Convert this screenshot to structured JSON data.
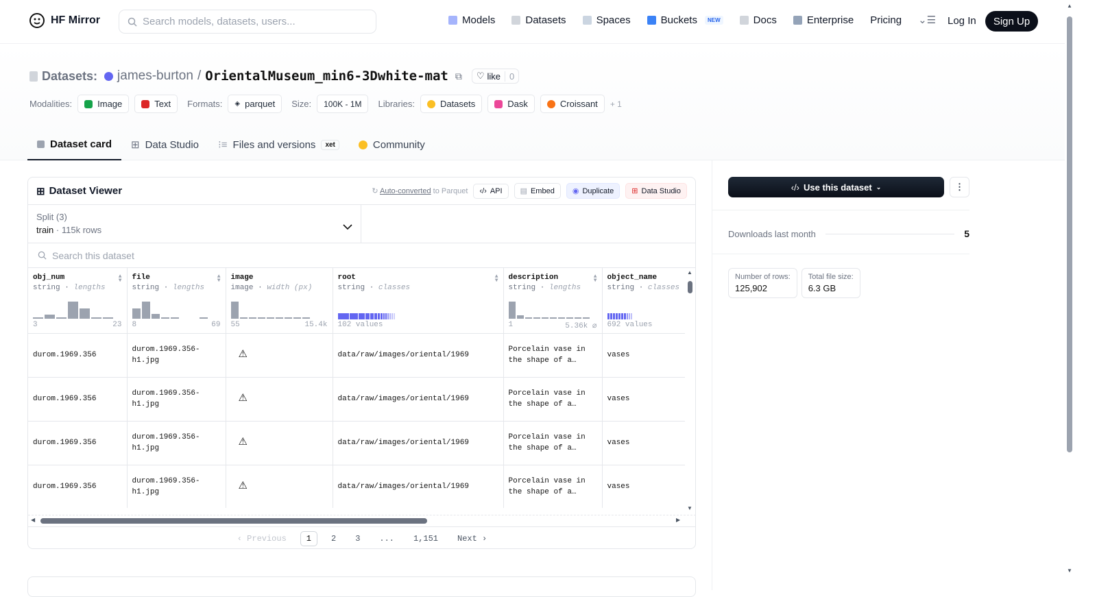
{
  "nav": {
    "brand": "HF Mirror",
    "search_placeholder": "Search models, datasets, users...",
    "links": [
      "Models",
      "Datasets",
      "Spaces",
      "Buckets",
      "Docs",
      "Enterprise",
      "Pricing"
    ],
    "new_badge": "NEW",
    "login": "Log In",
    "signup": "Sign Up"
  },
  "header": {
    "section_label": "Datasets:",
    "user": "james-burton",
    "separator": "/",
    "dataset_name": "OrientalMuseum_min6-3Dwhite-mat",
    "like_label": "like",
    "like_count": "0",
    "modalities_label": "Modalities:",
    "modalities": [
      "Image",
      "Text"
    ],
    "formats_label": "Formats:",
    "format": "parquet",
    "size_label": "Size:",
    "size": "100K - 1M",
    "libraries_label": "Libraries:",
    "libraries": [
      "Datasets",
      "Dask",
      "Croissant"
    ],
    "libraries_more": "+ 1"
  },
  "tabs": {
    "dataset_card": "Dataset card",
    "data_studio": "Data Studio",
    "files": "Files and versions",
    "xet": "xet",
    "community": "Community"
  },
  "viewer": {
    "title": "Dataset Viewer",
    "auto_converted": "Auto-converted",
    "to_parquet": " to Parquet",
    "api": "API",
    "embed": "Embed",
    "duplicate": "Duplicate",
    "data_studio": "Data Studio",
    "split_title": "Split (3)",
    "split_value": "train",
    "split_rows": "115k rows",
    "search_placeholder": "Search this dataset",
    "columns": [
      {
        "name": "obj_num",
        "type": "string",
        "stat": "lengths",
        "min": "3",
        "max": "23"
      },
      {
        "name": "file",
        "type": "string",
        "stat": "lengths",
        "min": "8",
        "max": "69"
      },
      {
        "name": "image",
        "type": "image",
        "stat": "width (px)",
        "min": "55",
        "max": "15.4k"
      },
      {
        "name": "root",
        "type": "string",
        "stat": "classes",
        "min": "102 values",
        "max": ""
      },
      {
        "name": "description",
        "type": "string",
        "stat": "lengths",
        "min": "1",
        "max": "5.36k ⌀"
      },
      {
        "name": "object_name",
        "type": "string",
        "stat": "classes",
        "min": "692 values",
        "max": ""
      }
    ],
    "rows": [
      {
        "obj_num": "durom.1969.356",
        "file": "durom.1969.356-h1.jpg",
        "root": "data/raw/images/oriental/1969",
        "description": "Porcelain vase in the shape of a…",
        "object_name": "vases"
      },
      {
        "obj_num": "durom.1969.356",
        "file": "durom.1969.356-h1.jpg",
        "root": "data/raw/images/oriental/1969",
        "description": "Porcelain vase in the shape of a…",
        "object_name": "vases"
      },
      {
        "obj_num": "durom.1969.356",
        "file": "durom.1969.356-h1.jpg",
        "root": "data/raw/images/oriental/1969",
        "description": "Porcelain vase in the shape of a…",
        "object_name": "vases"
      },
      {
        "obj_num": "durom.1969.356",
        "file": "durom.1969.356-h1.jpg",
        "root": "data/raw/images/oriental/1969",
        "description": "Porcelain vase in the shape of a…",
        "object_name": "vases"
      }
    ],
    "pager": {
      "previous": "Previous",
      "pages": [
        "1",
        "2",
        "3",
        "...",
        "1,151"
      ],
      "next": "Next"
    }
  },
  "sidebar": {
    "use_dataset": "Use this dataset",
    "downloads_label": "Downloads last month",
    "downloads_value": "5",
    "rows_label": "Number of rows:",
    "rows_value": "125,902",
    "filesize_label": "Total file size:",
    "filesize_value": "6.3 GB"
  },
  "colors": {
    "accent_dark": "#0b0f19",
    "class_bar": "#6366f1",
    "hist_bar": "#9ca3af"
  }
}
